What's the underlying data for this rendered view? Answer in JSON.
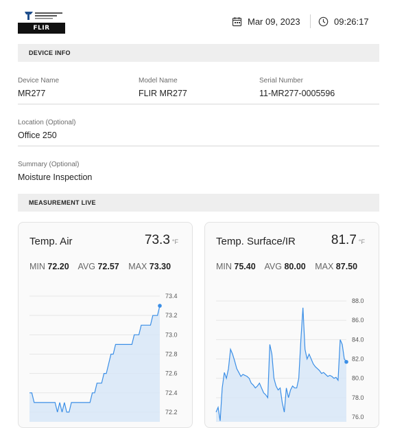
{
  "header": {
    "logo_top_text": "TELEDYNE FLIR",
    "logo_bar_text": "FLIR",
    "date": "Mar 09, 2023",
    "time": "09:26:17",
    "icons": {
      "date": "calendar-icon",
      "time": "clock-icon"
    }
  },
  "device_info": {
    "section_title": "DEVICE INFO",
    "device_name": {
      "label": "Device Name",
      "value": "MR277"
    },
    "model_name": {
      "label": "Model Name",
      "value": "FLIR MR277"
    },
    "serial_number": {
      "label": "Serial Number",
      "value": "11-MR277-0005596"
    },
    "location": {
      "label": "Location (Optional)",
      "value": "Office 250"
    },
    "summary": {
      "label": "Summary (Optional)",
      "value": "Moisture Inspection"
    }
  },
  "measurement": {
    "section_title": "MEASUREMENT LIVE",
    "cards": [
      {
        "title": "Temp. Air",
        "value": "73.3",
        "unit": "°F",
        "min_label": "MIN",
        "min": "72.20",
        "avg_label": "AVG",
        "avg": "72.57",
        "max_label": "MAX",
        "max": "73.30"
      },
      {
        "title": "Temp. Surface/IR",
        "value": "81.7",
        "unit": "°F",
        "min_label": "MIN",
        "min": "75.40",
        "avg_label": "AVG",
        "avg": "80.00",
        "max_label": "MAX",
        "max": "87.50"
      }
    ]
  },
  "colors": {
    "line": "#3a8ee6",
    "fill": "#d6e6f7",
    "section_bg": "#eeeeee"
  },
  "chart_data": [
    {
      "type": "area",
      "ylim": [
        72.1,
        73.45
      ],
      "y_ticks": [
        "73.4",
        "73.2",
        "73.0",
        "72.8",
        "72.6",
        "72.4",
        "72.2"
      ],
      "y_tick_values": [
        73.4,
        73.2,
        73.0,
        72.8,
        72.6,
        72.4,
        72.2
      ],
      "series": [
        {
          "values": [
            72.4,
            72.4,
            72.3,
            72.3,
            72.3,
            72.3,
            72.3,
            72.3,
            72.3,
            72.3,
            72.3,
            72.3,
            72.2,
            72.3,
            72.2,
            72.3,
            72.2,
            72.2,
            72.3,
            72.3,
            72.3,
            72.3,
            72.3,
            72.3,
            72.3,
            72.3,
            72.3,
            72.4,
            72.4,
            72.5,
            72.5,
            72.5,
            72.6,
            72.6,
            72.7,
            72.8,
            72.8,
            72.9,
            72.9,
            72.9,
            72.9,
            72.9,
            72.9,
            72.9,
            72.9,
            73.0,
            73.0,
            73.0,
            73.1,
            73.1,
            73.1,
            73.1,
            73.1,
            73.2,
            73.2,
            73.2,
            73.3
          ]
        }
      ]
    },
    {
      "type": "area",
      "ylim": [
        75.5,
        89.0
      ],
      "y_ticks": [
        "88.0",
        "86.0",
        "84.0",
        "82.0",
        "80.0",
        "78.0",
        "76.0"
      ],
      "y_tick_values": [
        88.0,
        86.0,
        84.0,
        82.0,
        80.0,
        78.0,
        76.0
      ],
      "series": [
        {
          "values": [
            76.5,
            77.0,
            75.6,
            79.0,
            80.6,
            80.0,
            81.0,
            83.0,
            82.5,
            81.8,
            81.0,
            80.6,
            80.2,
            80.4,
            80.3,
            80.2,
            80.0,
            79.5,
            79.3,
            79.0,
            79.2,
            79.5,
            79.0,
            78.5,
            78.3,
            78.0,
            83.5,
            82.5,
            80.0,
            79.2,
            78.8,
            79.0,
            77.5,
            76.5,
            79.0,
            78.0,
            78.8,
            79.2,
            79.0,
            79.0,
            80.0,
            84.0,
            87.3,
            83.0,
            82.0,
            82.5,
            82.0,
            81.5,
            81.2,
            81.0,
            80.8,
            80.5,
            80.6,
            80.4,
            80.2,
            80.3,
            80.2,
            80.0,
            80.1,
            79.8,
            84.0,
            83.5,
            82.0,
            81.7
          ]
        }
      ]
    }
  ]
}
